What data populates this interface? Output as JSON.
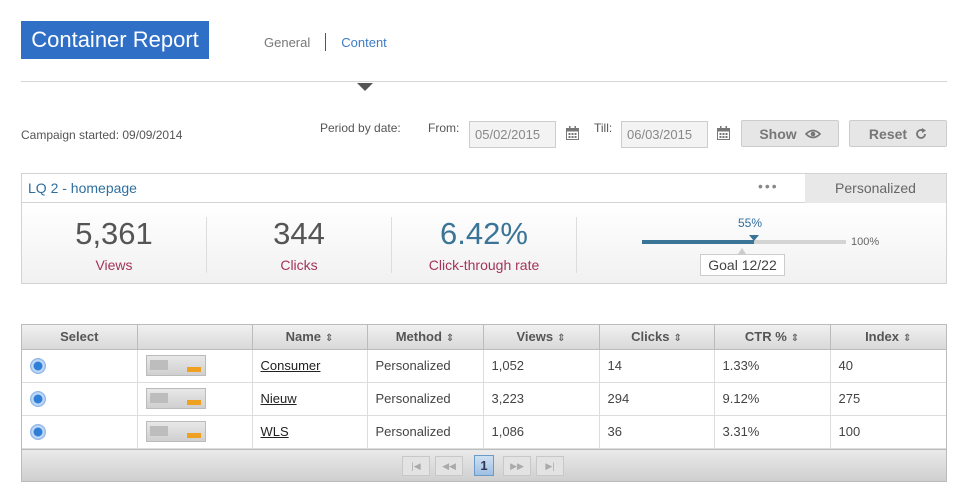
{
  "header": {
    "title": "Container Report",
    "tabs": [
      {
        "label": "General",
        "active": false
      },
      {
        "label": "Content",
        "active": true
      }
    ]
  },
  "filters": {
    "campaign_started": "Campaign started: 09/09/2014",
    "period_label": "Period by date:",
    "from_label": "From:",
    "from_value": "05/02/2015",
    "till_label": "Till:",
    "till_value": "06/03/2015",
    "show_label": "Show",
    "reset_label": "Reset"
  },
  "summary": {
    "title": "LQ 2 - homepage",
    "menu": "•••",
    "badge": "Personalized",
    "metrics": [
      {
        "value": "5,361",
        "label": "Views"
      },
      {
        "value": "344",
        "label": "Clicks"
      },
      {
        "value": "6.42%",
        "label": "Click-through rate"
      }
    ],
    "progress_label": "55%",
    "progress_value": 0.55,
    "progress_max_label": "100%",
    "goal": "Goal 12/22"
  },
  "table": {
    "columns": [
      "Select",
      "",
      "Name",
      "Method",
      "Views",
      "Clicks",
      "CTR %",
      "Index"
    ],
    "rows": [
      {
        "name": "Consumer",
        "method": "Personalized",
        "views": "1,052",
        "clicks": "14",
        "ctr": "1.33%",
        "index": "40"
      },
      {
        "name": "Nieuw",
        "method": "Personalized",
        "views": "3,223",
        "clicks": "294",
        "ctr": "9.12%",
        "index": "275"
      },
      {
        "name": "WLS",
        "method": "Personalized",
        "views": "1,086",
        "clicks": "36",
        "ctr": "3.31%",
        "index": "100"
      }
    ],
    "pager": {
      "current": "1"
    }
  },
  "colors": {
    "brand": "#2f6fc6",
    "accent": "#3a7497",
    "metric_label": "#a3345a"
  }
}
